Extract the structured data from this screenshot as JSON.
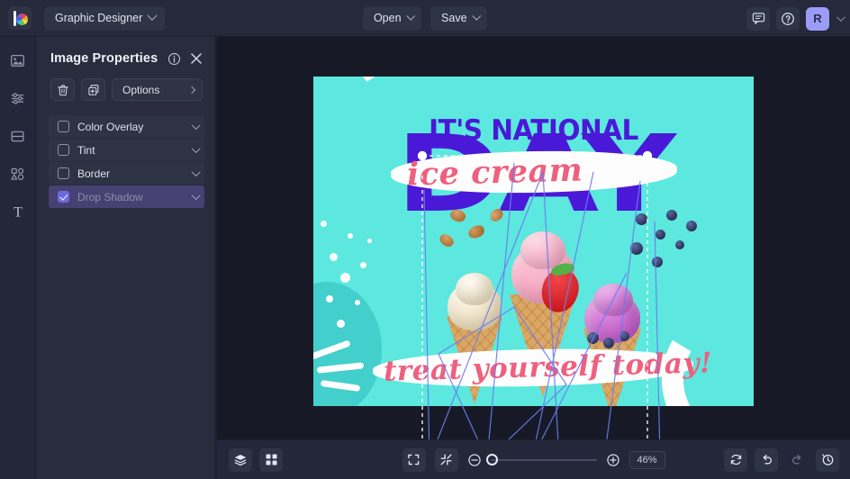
{
  "topbar": {
    "logo_icon": "befunky-logo-icon",
    "app_mode": "Graphic Designer",
    "open_label": "Open",
    "save_label": "Save",
    "chat_icon": "chat-icon",
    "help_icon": "help-icon",
    "avatar_initial": "R"
  },
  "rail": {
    "items": [
      {
        "name": "image-tool",
        "icon": "image-icon"
      },
      {
        "name": "edit-tool",
        "icon": "sliders-icon"
      },
      {
        "name": "frames-tool",
        "icon": "frame-icon"
      },
      {
        "name": "graphics-tool",
        "icon": "shapes-icon"
      },
      {
        "name": "text-tool",
        "icon": "text-icon",
        "glyph": "T"
      }
    ]
  },
  "panel": {
    "title": "Image Properties",
    "info_icon": "info-icon",
    "close_icon": "close-icon",
    "delete_icon": "trash-icon",
    "duplicate_icon": "duplicate-icon",
    "options_label": "Options",
    "properties": [
      {
        "label": "Color Overlay",
        "checked": false
      },
      {
        "label": "Tint",
        "checked": false
      },
      {
        "label": "Border",
        "checked": false
      },
      {
        "label": "Drop Shadow",
        "checked": true
      }
    ]
  },
  "canvas": {
    "background_color": "#5ce8de",
    "headline": "IT'S NATIONAL",
    "script_top": "ice cream",
    "bigword": "DAY",
    "script_bottom": "treat yourself today!",
    "headline_color": "#4a19d8",
    "script_color": "#ef5f7e",
    "selection_handle_icon": "selection-handle"
  },
  "bottombar": {
    "layers_icon": "layers-icon",
    "grid_icon": "grid-icon",
    "fit_icon": "fit-screen-icon",
    "shrink_icon": "shrink-icon",
    "zoom_out_icon": "zoom-out-icon",
    "zoom_in_icon": "zoom-in-icon",
    "zoom_value": "46%",
    "reset_icon": "reset-icon",
    "undo_icon": "undo-icon",
    "redo_icon": "redo-icon",
    "history_icon": "history-icon"
  }
}
